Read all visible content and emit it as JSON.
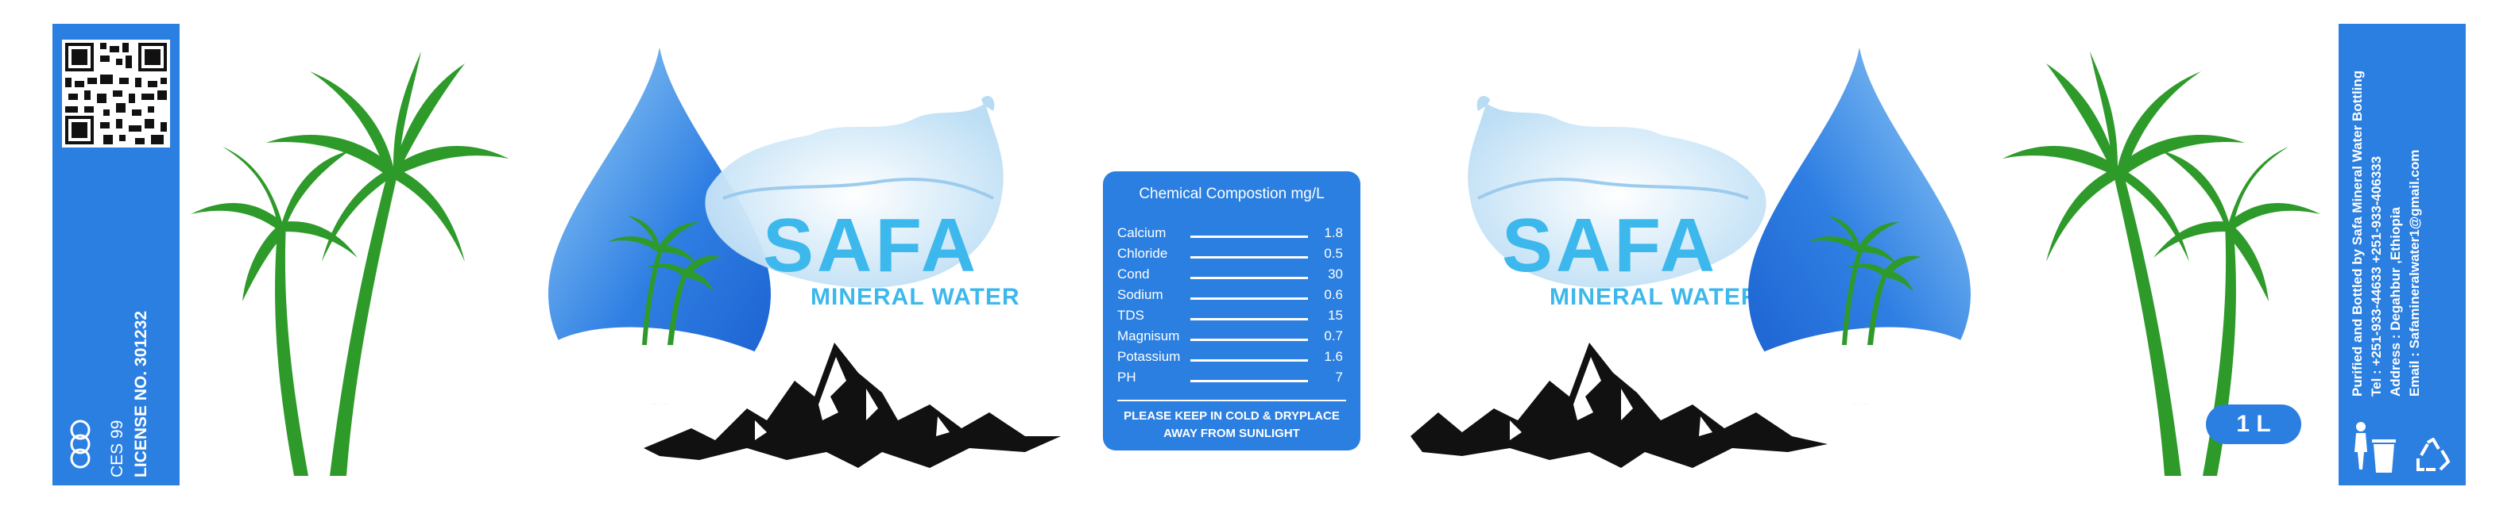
{
  "left_strip": {
    "license": "LICENSE NO. 301232",
    "standard": "CES 99"
  },
  "brand": {
    "name": "SAFA",
    "tagline": "MINERAL WATER"
  },
  "chemical_panel": {
    "title": "Chemical Compostion mg/L",
    "rows": [
      {
        "name": "Calcium",
        "value": "1.8"
      },
      {
        "name": "Chloride",
        "value": "0.5"
      },
      {
        "name": "Cond",
        "value": "30"
      },
      {
        "name": "Sodium",
        "value": "0.6"
      },
      {
        "name": "TDS",
        "value": "15"
      },
      {
        "name": "Magnisum",
        "value": "0.7"
      },
      {
        "name": "Potassium",
        "value": "1.6"
      },
      {
        "name": "PH",
        "value": "7"
      }
    ],
    "note_line1": "PLEASE KEEP IN COLD & DRYPLACE",
    "note_line2": "AWAY FROM SUNLIGHT"
  },
  "volume": "1 L",
  "right_strip": {
    "line1": "Purified and Bottled by Safa Mineral Water Bottling",
    "line2": "Tel : +251-933-44633 +251-933-406333",
    "line3": "Address : Degahbur ,Ethiopia",
    "line4": "Email : Safamineralwater1@gmail.com"
  },
  "colors": {
    "strip_blue": "#2b7fe0",
    "brand_cyan": "#3db8ec",
    "palm_green": "#2e9a2a"
  }
}
